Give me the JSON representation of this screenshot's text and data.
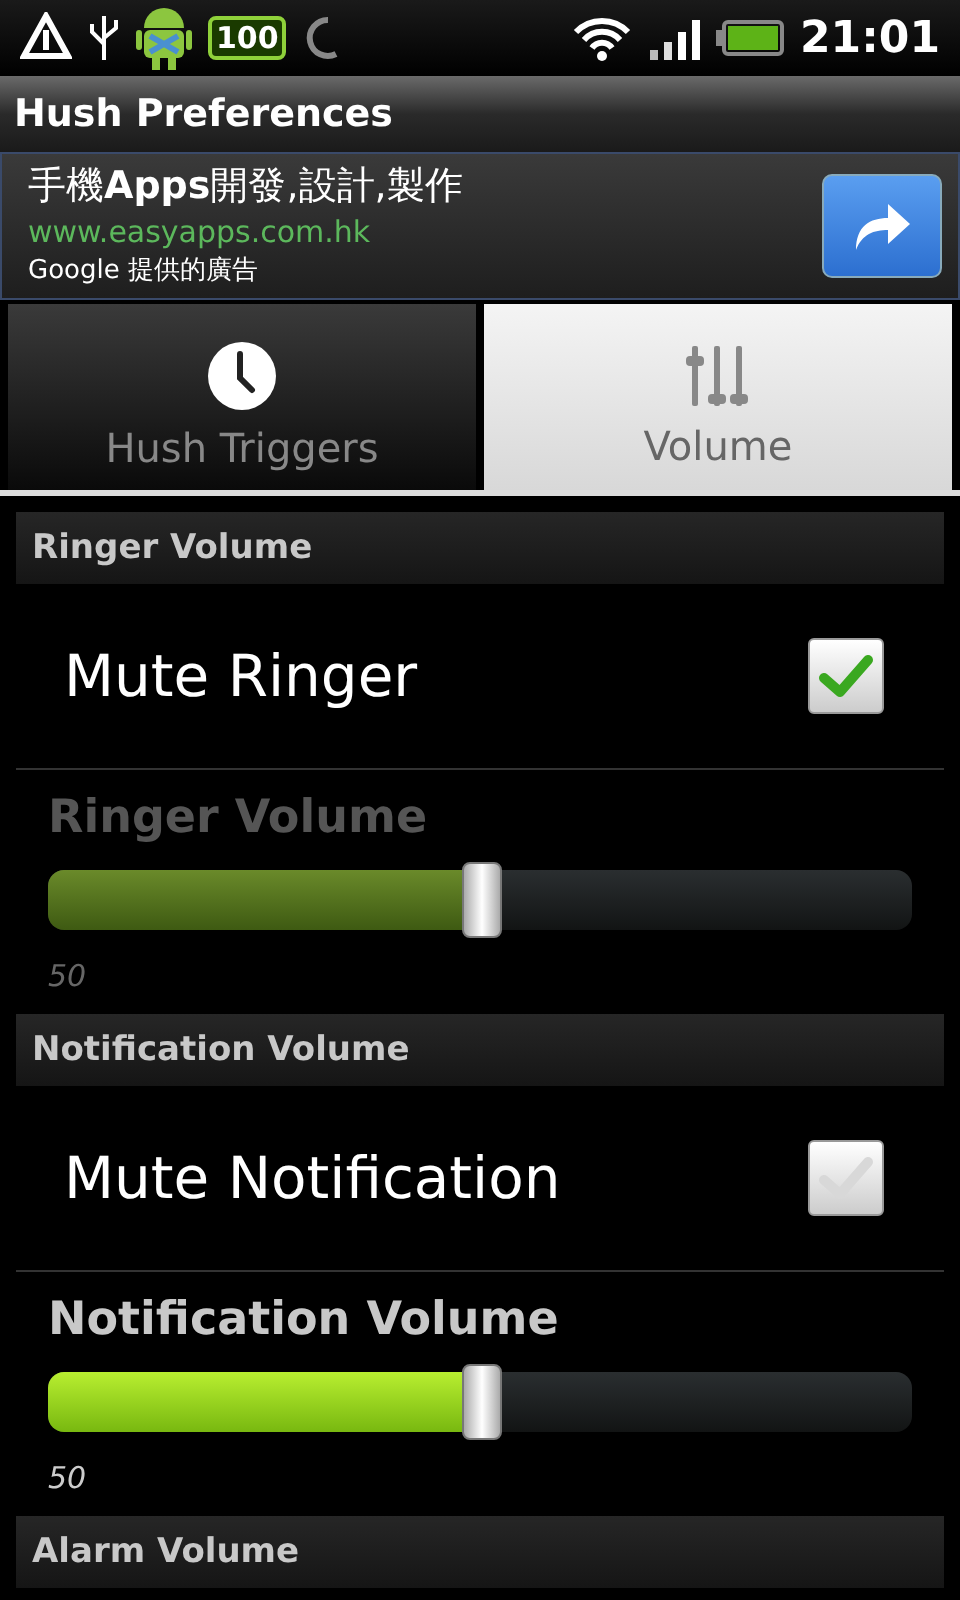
{
  "status_bar": {
    "battery_badge": "100",
    "time": "21:01"
  },
  "window": {
    "title": "Hush Preferences"
  },
  "ad": {
    "headline": "手機**Apps**開發,設計,製作",
    "url": "www.easyapps.com.hk",
    "attribution": "Google 提供的廣告"
  },
  "tabs": [
    {
      "label": "Hush Triggers",
      "selected": false
    },
    {
      "label": "Volume",
      "selected": true
    }
  ],
  "sections": [
    {
      "title": "Ringer Volume",
      "items": [
        {
          "kind": "checkbox",
          "label": "Mute Ringer",
          "checked": true
        },
        {
          "kind": "slider",
          "label": "Ringer Volume",
          "level": 0.5,
          "reading": "50",
          "disabled": true
        }
      ]
    },
    {
      "title": "Notification Volume",
      "items": [
        {
          "kind": "checkbox",
          "label": "Mute Notification",
          "checked": false
        },
        {
          "kind": "slider",
          "label": "Notification Volume",
          "level": 0.5,
          "reading": "50",
          "disabled": false
        }
      ]
    },
    {
      "title": "Alarm Volume"
    }
  ]
}
